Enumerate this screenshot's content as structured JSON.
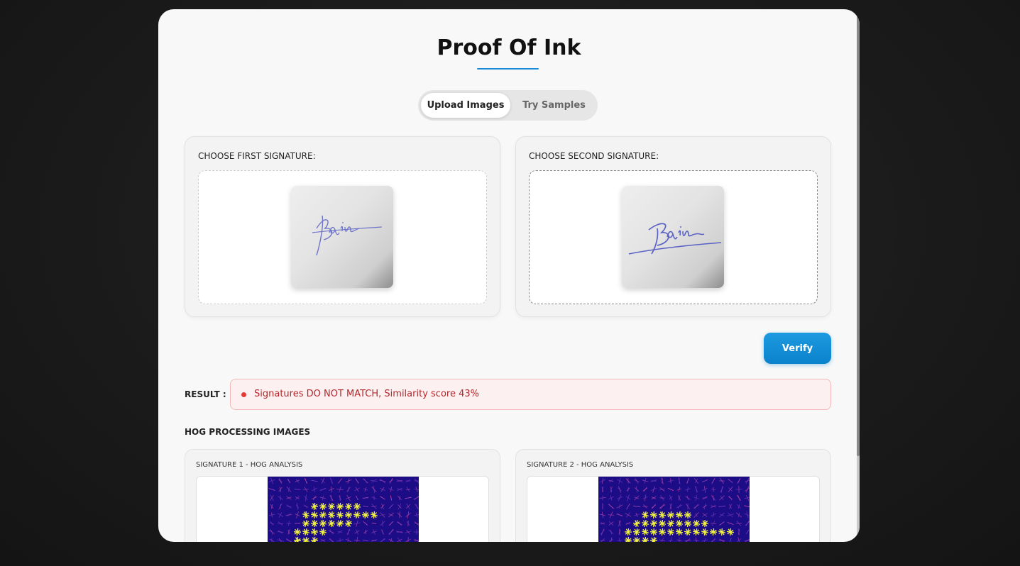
{
  "app": {
    "title": "Proof Of Ink"
  },
  "tabs": {
    "upload_label": "Upload Images",
    "samples_label": "Try Samples",
    "active": "Upload Images"
  },
  "signatures": {
    "first": {
      "label": "CHOOSE FIRST SIGNATURE:",
      "sample_text": "Bjain"
    },
    "second": {
      "label": "CHOOSE SECOND SIGNATURE:",
      "sample_text": "Bjain"
    }
  },
  "actions": {
    "verify_label": "Verify"
  },
  "result": {
    "label": "RESULT :",
    "message": "Signatures DO NOT MATCH, Similarity score 43%",
    "similarity_percent": 43,
    "status_color": "#e53935"
  },
  "hog": {
    "heading": "HOG PROCESSING IMAGES",
    "panel1_label": "SIGNATURE 1 - HOG ANALYSIS",
    "panel2_label": "SIGNATURE 2 - HOG ANALYSIS"
  },
  "colors": {
    "accent": "#0b82cc",
    "hog_background": "#1c0c86",
    "hog_highlight": "#f5f542"
  }
}
